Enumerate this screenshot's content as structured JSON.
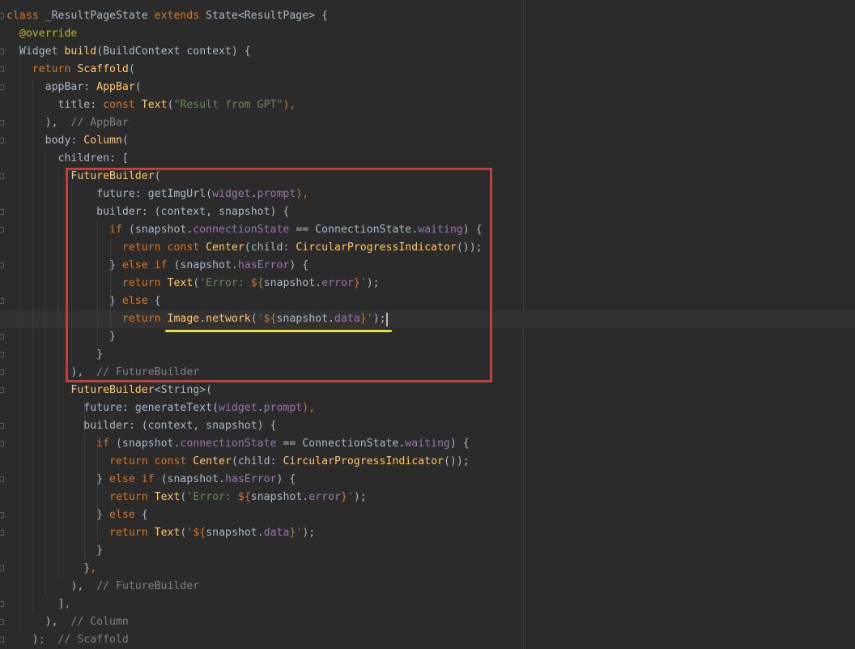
{
  "editor": {
    "language": "dart",
    "colors": {
      "background": "#2b2b2b",
      "keyword": "#cc7832",
      "function": "#ffc66d",
      "property": "#9876aa",
      "string": "#6a8759",
      "comment": "#808080",
      "annotation": "#bbb529",
      "highlight_box": "#e8302a",
      "highlight_underline": "#f2e500"
    },
    "lines": [
      [
        {
          "t": "class",
          "c": "kw"
        },
        {
          "t": " _ResultPageState ",
          "c": "txt"
        },
        {
          "t": "extends",
          "c": "kw"
        },
        {
          "t": " State<ResultPage> {",
          "c": "txt"
        }
      ],
      [
        {
          "t": "  ",
          "c": "txt"
        },
        {
          "t": "@override",
          "c": "ann"
        }
      ],
      [
        {
          "t": "  Widget ",
          "c": "txt"
        },
        {
          "t": "build",
          "c": "fn"
        },
        {
          "t": "(BuildContext context) {",
          "c": "txt"
        }
      ],
      [
        {
          "t": "    ",
          "c": "txt"
        },
        {
          "t": "return",
          "c": "kw"
        },
        {
          "t": " ",
          "c": "txt"
        },
        {
          "t": "Scaffold",
          "c": "fn"
        },
        {
          "t": "(",
          "c": "txt"
        }
      ],
      [
        {
          "t": "      appBar: ",
          "c": "txt"
        },
        {
          "t": "AppBar",
          "c": "fn"
        },
        {
          "t": "(",
          "c": "txt"
        }
      ],
      [
        {
          "t": "        title: ",
          "c": "txt"
        },
        {
          "t": "const",
          "c": "kw"
        },
        {
          "t": " ",
          "c": "txt"
        },
        {
          "t": "Text",
          "c": "fn"
        },
        {
          "t": "(",
          "c": "txt"
        },
        {
          "t": "\"Result from GPT\"",
          "c": "str"
        },
        {
          "t": "),",
          "c": "kw"
        }
      ],
      [
        {
          "t": "      ),",
          "c": "txt"
        },
        {
          "t": "  // AppBar",
          "c": "cm"
        }
      ],
      [
        {
          "t": "      body: ",
          "c": "txt"
        },
        {
          "t": "Column",
          "c": "fn"
        },
        {
          "t": "(",
          "c": "txt"
        }
      ],
      [
        {
          "t": "        children: [",
          "c": "txt"
        }
      ],
      [
        {
          "t": "          ",
          "c": "txt"
        },
        {
          "t": "FutureBuilder",
          "c": "fn"
        },
        {
          "t": "(",
          "c": "txt"
        }
      ],
      [
        {
          "t": "              future: getImgUrl(",
          "c": "txt"
        },
        {
          "t": "widget",
          "c": "prop"
        },
        {
          "t": ".",
          "c": "txt"
        },
        {
          "t": "prompt",
          "c": "prop"
        },
        {
          "t": "),",
          "c": "kw"
        }
      ],
      [
        {
          "t": "              builder: (context, snapshot) {",
          "c": "txt"
        }
      ],
      [
        {
          "t": "                ",
          "c": "txt"
        },
        {
          "t": "if",
          "c": "kw"
        },
        {
          "t": " (snapshot.",
          "c": "txt"
        },
        {
          "t": "connectionState",
          "c": "prop"
        },
        {
          "t": " == ConnectionState.",
          "c": "txt"
        },
        {
          "t": "waiting",
          "c": "prop"
        },
        {
          "t": ") {",
          "c": "txt"
        }
      ],
      [
        {
          "t": "                  ",
          "c": "txt"
        },
        {
          "t": "return const",
          "c": "kw"
        },
        {
          "t": " ",
          "c": "txt"
        },
        {
          "t": "Center",
          "c": "fn"
        },
        {
          "t": "(child: ",
          "c": "txt"
        },
        {
          "t": "CircularProgressIndicator",
          "c": "fn"
        },
        {
          "t": "());",
          "c": "txt"
        }
      ],
      [
        {
          "t": "                } ",
          "c": "txt"
        },
        {
          "t": "else if",
          "c": "kw"
        },
        {
          "t": " (snapshot.",
          "c": "txt"
        },
        {
          "t": "hasError",
          "c": "prop"
        },
        {
          "t": ") {",
          "c": "txt"
        }
      ],
      [
        {
          "t": "                  ",
          "c": "txt"
        },
        {
          "t": "return",
          "c": "kw"
        },
        {
          "t": " ",
          "c": "txt"
        },
        {
          "t": "Text",
          "c": "fn"
        },
        {
          "t": "(",
          "c": "txt"
        },
        {
          "t": "'Error: ",
          "c": "str"
        },
        {
          "t": "${",
          "c": "kw"
        },
        {
          "t": "snapshot.",
          "c": "txt"
        },
        {
          "t": "error",
          "c": "prop"
        },
        {
          "t": "}",
          "c": "kw"
        },
        {
          "t": "'",
          "c": "str"
        },
        {
          "t": ");",
          "c": "txt"
        }
      ],
      [
        {
          "t": "                } ",
          "c": "txt"
        },
        {
          "t": "else",
          "c": "kw"
        },
        {
          "t": " {",
          "c": "txt"
        }
      ],
      [
        {
          "t": "                  ",
          "c": "txt"
        },
        {
          "t": "return",
          "c": "kw"
        },
        {
          "t": " ",
          "c": "txt"
        },
        {
          "t": "Image",
          "c": "fn"
        },
        {
          "t": ".",
          "c": "txt"
        },
        {
          "t": "network",
          "c": "fn"
        },
        {
          "t": "(",
          "c": "txt"
        },
        {
          "t": "'",
          "c": "str"
        },
        {
          "t": "${",
          "c": "kw"
        },
        {
          "t": "snapshot.",
          "c": "txt"
        },
        {
          "t": "data",
          "c": "prop"
        },
        {
          "t": "}",
          "c": "kw"
        },
        {
          "t": "'",
          "c": "str"
        },
        {
          "t": ");",
          "c": "txt"
        }
      ],
      [
        {
          "t": "                }",
          "c": "txt"
        }
      ],
      [
        {
          "t": "              }",
          "c": "txt"
        }
      ],
      [
        {
          "t": "          ),",
          "c": "txt"
        },
        {
          "t": "  // FutureBuilder",
          "c": "cm"
        }
      ],
      [
        {
          "t": "          ",
          "c": "txt"
        },
        {
          "t": "FutureBuilder",
          "c": "fn"
        },
        {
          "t": "<String>(",
          "c": "txt"
        }
      ],
      [
        {
          "t": "            future: generateText(",
          "c": "txt"
        },
        {
          "t": "widget",
          "c": "prop"
        },
        {
          "t": ".",
          "c": "txt"
        },
        {
          "t": "prompt",
          "c": "prop"
        },
        {
          "t": "),",
          "c": "kw"
        }
      ],
      [
        {
          "t": "            builder: (context, snapshot) {",
          "c": "txt"
        }
      ],
      [
        {
          "t": "              ",
          "c": "txt"
        },
        {
          "t": "if",
          "c": "kw"
        },
        {
          "t": " (snapshot.",
          "c": "txt"
        },
        {
          "t": "connectionState",
          "c": "prop"
        },
        {
          "t": " == ConnectionState.",
          "c": "txt"
        },
        {
          "t": "waiting",
          "c": "prop"
        },
        {
          "t": ") {",
          "c": "txt"
        }
      ],
      [
        {
          "t": "                ",
          "c": "txt"
        },
        {
          "t": "return const",
          "c": "kw"
        },
        {
          "t": " ",
          "c": "txt"
        },
        {
          "t": "Center",
          "c": "fn"
        },
        {
          "t": "(child: ",
          "c": "txt"
        },
        {
          "t": "CircularProgressIndicator",
          "c": "fn"
        },
        {
          "t": "());",
          "c": "txt"
        }
      ],
      [
        {
          "t": "              } ",
          "c": "txt"
        },
        {
          "t": "else if",
          "c": "kw"
        },
        {
          "t": " (snapshot.",
          "c": "txt"
        },
        {
          "t": "hasError",
          "c": "prop"
        },
        {
          "t": ") {",
          "c": "txt"
        }
      ],
      [
        {
          "t": "                ",
          "c": "txt"
        },
        {
          "t": "return",
          "c": "kw"
        },
        {
          "t": " ",
          "c": "txt"
        },
        {
          "t": "Text",
          "c": "fn"
        },
        {
          "t": "(",
          "c": "txt"
        },
        {
          "t": "'Error: ",
          "c": "str"
        },
        {
          "t": "${",
          "c": "kw"
        },
        {
          "t": "snapshot.",
          "c": "txt"
        },
        {
          "t": "error",
          "c": "prop"
        },
        {
          "t": "}",
          "c": "kw"
        },
        {
          "t": "'",
          "c": "str"
        },
        {
          "t": ");",
          "c": "txt"
        }
      ],
      [
        {
          "t": "              } ",
          "c": "txt"
        },
        {
          "t": "else",
          "c": "kw"
        },
        {
          "t": " {",
          "c": "txt"
        }
      ],
      [
        {
          "t": "                ",
          "c": "txt"
        },
        {
          "t": "return",
          "c": "kw"
        },
        {
          "t": " ",
          "c": "txt"
        },
        {
          "t": "Text",
          "c": "fn"
        },
        {
          "t": "(",
          "c": "txt"
        },
        {
          "t": "'",
          "c": "str"
        },
        {
          "t": "${",
          "c": "kw"
        },
        {
          "t": "snapshot.",
          "c": "txt"
        },
        {
          "t": "data",
          "c": "prop"
        },
        {
          "t": "}",
          "c": "kw"
        },
        {
          "t": "'",
          "c": "str"
        },
        {
          "t": ");",
          "c": "txt"
        }
      ],
      [
        {
          "t": "              }",
          "c": "txt"
        }
      ],
      [
        {
          "t": "            }",
          "c": "txt"
        },
        {
          "t": ",",
          "c": "kw"
        }
      ],
      [
        {
          "t": "          ),",
          "c": "txt"
        },
        {
          "t": "  // FutureBuilder",
          "c": "cm"
        }
      ],
      [
        {
          "t": "        ]",
          "c": "txt"
        },
        {
          "t": ",",
          "c": "kw"
        }
      ],
      [
        {
          "t": "      ),",
          "c": "txt"
        },
        {
          "t": "  // Column",
          "c": "cm"
        }
      ],
      [
        {
          "t": "    )",
          "c": "txt"
        },
        {
          "t": ";",
          "c": "kw"
        },
        {
          "t": "  // Scaffold",
          "c": "cm"
        }
      ]
    ]
  }
}
